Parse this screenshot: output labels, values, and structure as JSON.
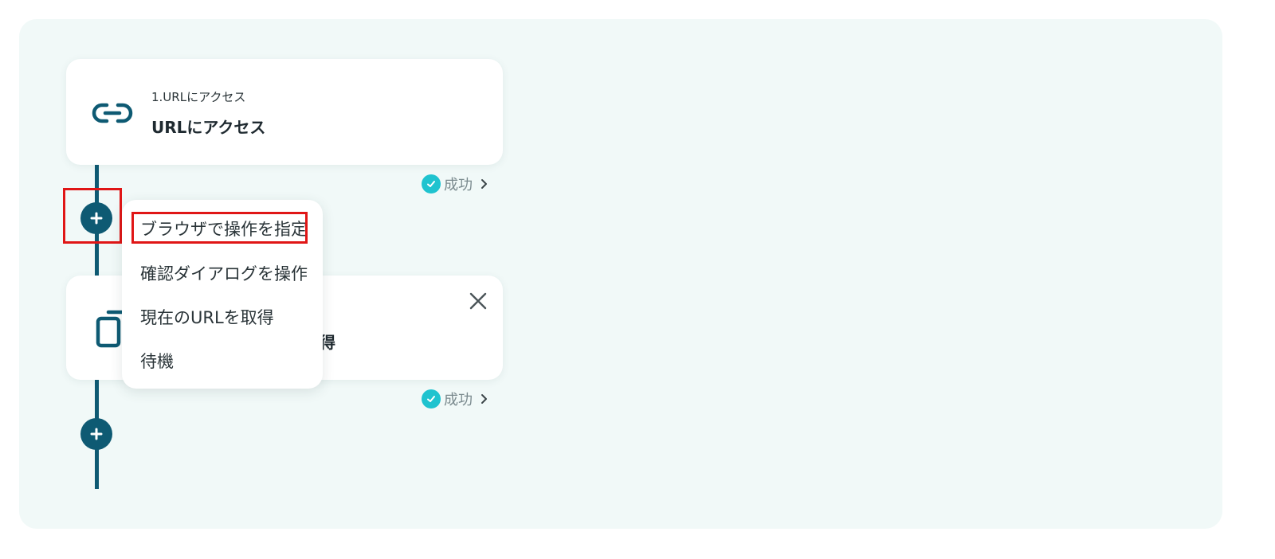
{
  "steps": [
    {
      "index_label": "1.URLにアクセス",
      "title": "URLにアクセス",
      "icon": "link-icon",
      "status": "成功"
    },
    {
      "title_visible_tail": "得",
      "icon": "copy-icon",
      "status": "成功"
    }
  ],
  "menu": {
    "items": [
      {
        "label": "ブラウザで操作を指定",
        "highlighted": true
      },
      {
        "label": "確認ダイアログを操作"
      },
      {
        "label": "現在のURLを取得"
      },
      {
        "label": "待機"
      }
    ]
  },
  "colors": {
    "canvas_bg": "#f1f9f8",
    "accent": "#0e5a73",
    "success": "#1fc3cf",
    "highlight": "#e01616"
  }
}
